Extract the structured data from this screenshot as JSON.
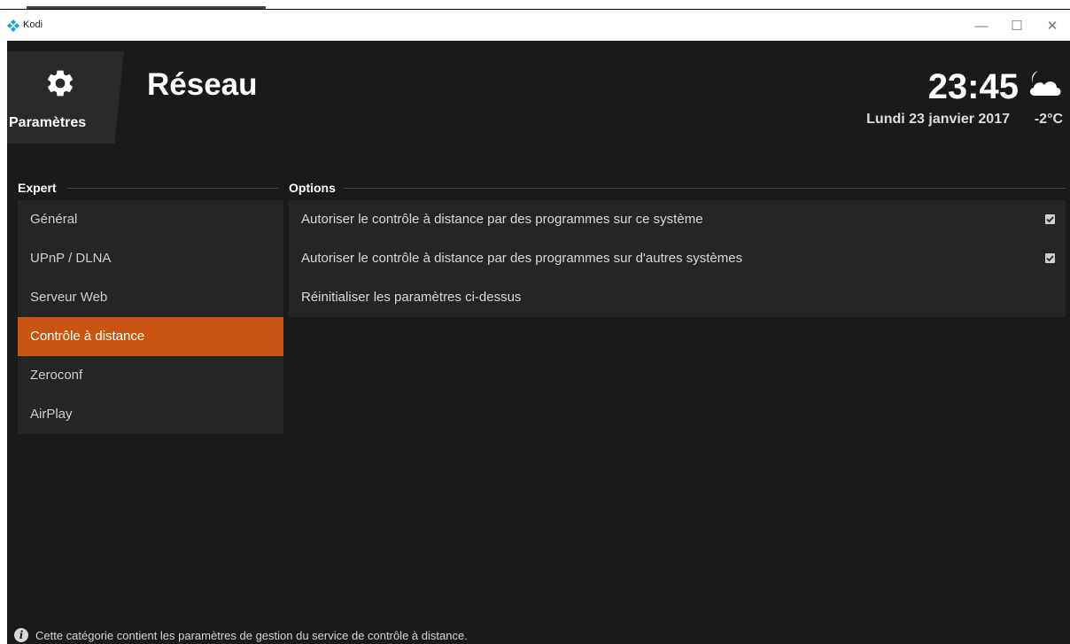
{
  "window": {
    "title": "Kodi",
    "minimize": "—",
    "maximize": "☐",
    "close": "✕"
  },
  "header": {
    "section_label": "Paramètres",
    "page_title": "Réseau",
    "time": "23:45",
    "date": "Lundi 23 janvier 2017",
    "temperature": "-2°C",
    "weather_icon": "partly-cloudy-night-icon"
  },
  "sidebar": {
    "heading": "Expert",
    "items": [
      {
        "label": "Général"
      },
      {
        "label": "UPnP / DLNA"
      },
      {
        "label": "Serveur Web"
      },
      {
        "label": "Contrôle à distance",
        "selected": true
      },
      {
        "label": "Zeroconf"
      },
      {
        "label": "AirPlay"
      }
    ]
  },
  "options": {
    "heading": "Options",
    "rows": [
      {
        "label": "Autoriser le contrôle à distance par des programmes sur ce système",
        "checked": true
      },
      {
        "label": "Autoriser le contrôle à distance par des programmes sur d'autres systèmes",
        "checked": true
      },
      {
        "label": "Réinitialiser les paramètres ci-dessus"
      }
    ]
  },
  "footer": {
    "info_text": "Cette catégorie contient les paramètres de gestion du service de contrôle à distance."
  },
  "colors": {
    "accent": "#c85612",
    "background": "#1a1a1a",
    "panel": "#252525"
  }
}
